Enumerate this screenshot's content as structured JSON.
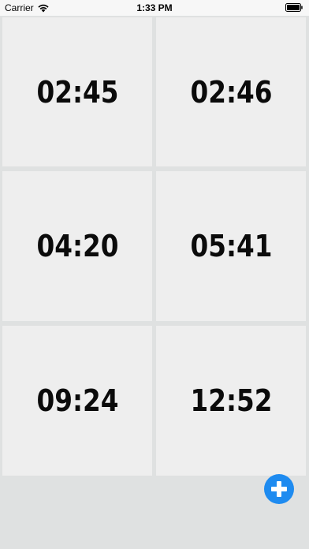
{
  "status_bar": {
    "carrier": "Carrier",
    "time": "1:33 PM",
    "icons": [
      "wifi-icon",
      "battery-icon"
    ]
  },
  "timers": [
    {
      "time": "02:45"
    },
    {
      "time": "02:46"
    },
    {
      "time": "04:20"
    },
    {
      "time": "05:41"
    },
    {
      "time": "09:24"
    },
    {
      "time": "12:52"
    }
  ],
  "add_button": {
    "icon": "plus-icon",
    "color": "#1e8bf0"
  },
  "colors": {
    "background": "#dfe1e1",
    "tile": "#eeeeee",
    "text": "#0b0b0b"
  }
}
